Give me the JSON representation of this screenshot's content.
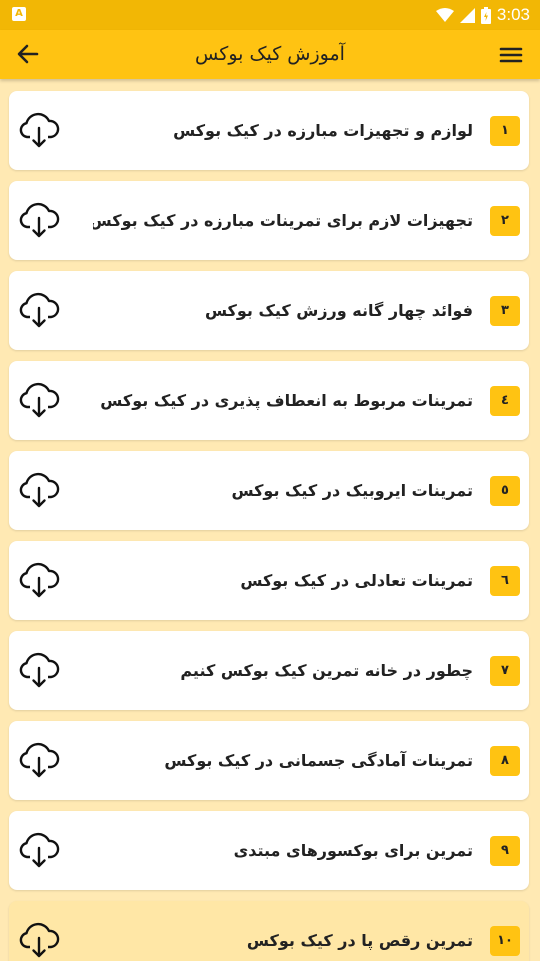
{
  "status_bar": {
    "time": "3:03",
    "notification_badge": "A"
  },
  "app_bar": {
    "title": "آموزش کیک بوکس"
  },
  "colors": {
    "accent": "#FFC312",
    "status": "#F2B705",
    "background": "#FFE9B3",
    "active_card": "#FFE7A6"
  },
  "items": [
    {
      "num": "۱",
      "label": "لوازم و تجهیزات مبارزه در کیک بوکس",
      "icon": "cloud-download-icon"
    },
    {
      "num": "۲",
      "label": "تجهیزات لازم برای تمرینات مبارزه در کیک بوکس",
      "icon": "cloud-download-icon"
    },
    {
      "num": "۳",
      "label": "فوائد چهار گانه ورزش کیک بوکس",
      "icon": "cloud-download-icon"
    },
    {
      "num": "٤",
      "label": "تمرینات مربوط به انعطاف پذیری در کیک بوکس",
      "icon": "cloud-download-icon"
    },
    {
      "num": "٥",
      "label": "تمرینات ایروبیک در کیک بوکس",
      "icon": "cloud-download-icon"
    },
    {
      "num": "٦",
      "label": "تمرینات تعادلی در کیک بوکس",
      "icon": "cloud-download-icon"
    },
    {
      "num": "۷",
      "label": "چطور در خانه تمرین کیک بوکس کنیم",
      "icon": "cloud-download-icon"
    },
    {
      "num": "۸",
      "label": "تمرینات آمادگی جسمانی در کیک بوکس",
      "icon": "cloud-download-icon"
    },
    {
      "num": "۹",
      "label": "تمرین برای بوکسورهای مبتدی",
      "icon": "cloud-download-icon"
    },
    {
      "num": "۱۰",
      "label": "تمرین رقص پا در کیک بوکس",
      "icon": "cloud-download-icon"
    }
  ]
}
